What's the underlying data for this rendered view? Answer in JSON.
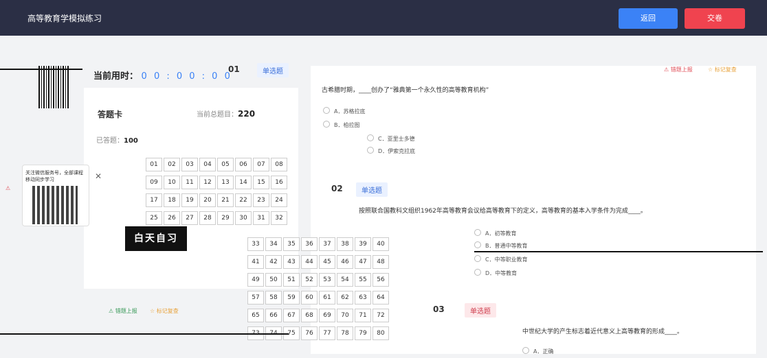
{
  "header": {
    "title": "高等教育学模拟练习",
    "back_label": "返回",
    "submit_label": "交卷"
  },
  "timer": {
    "label": "当前用时",
    "value": "0 0 : 0 0 : 0 0"
  },
  "answer_card": {
    "title": "答题卡",
    "total_label": "当前总题目：",
    "total_value": "220",
    "done_label": "已答题：",
    "done_value": "100"
  },
  "grid_a": [
    "01",
    "02",
    "03",
    "04",
    "05",
    "06",
    "07",
    "08",
    "09",
    "10",
    "11",
    "12",
    "13",
    "14",
    "15",
    "16",
    "17",
    "18",
    "19",
    "20",
    "21",
    "22",
    "23",
    "24",
    "25",
    "26",
    "27",
    "28",
    "29",
    "30",
    "31",
    "32"
  ],
  "grid_b": [
    "33",
    "34",
    "35",
    "36",
    "37",
    "38",
    "39",
    "40",
    "41",
    "42",
    "43",
    "44",
    "45",
    "46",
    "47",
    "48",
    "49",
    "50",
    "51",
    "52",
    "53",
    "54",
    "55",
    "56",
    "57",
    "58",
    "59",
    "60",
    "61",
    "62",
    "63",
    "64",
    "65",
    "66",
    "67",
    "68",
    "69",
    "70",
    "71",
    "72",
    "73",
    "74",
    "75",
    "76",
    "77",
    "78",
    "79",
    "80"
  ],
  "questions": [
    {
      "num": "01",
      "type": "单选题",
      "stem": "古希腊时期，____创办了“雅典第一个永久性的高等教育机构”",
      "options": [
        "A．苏格拉底",
        "B．柏拉图",
        "C．亚里士多德",
        "D．伊索克拉底"
      ]
    },
    {
      "num": "02",
      "type": "单选题",
      "stem": "按照联合国教科文组织1962年高等教育会议给高等教育下的定义，高等教育的基本入学条件为完成____。",
      "options": [
        "A．初等教育",
        "B．普通中等教育",
        "C．中等职业教育",
        "D．中等教育"
      ]
    },
    {
      "num": "03",
      "type": "单选题",
      "stem": "中世纪大学的产生标志着近代意义上高等教育的形成____。",
      "options": [
        "A．正确"
      ]
    }
  ],
  "actions": {
    "report": "错题上报",
    "mark": "标记复查"
  },
  "promo": {
    "text": "关注微信服务号，全部课程移动同步学习",
    "stamp": "白天自习"
  },
  "colors": {
    "header_bg": "#2b2f45",
    "back": "#3b82f6",
    "submit": "#f0434f"
  }
}
